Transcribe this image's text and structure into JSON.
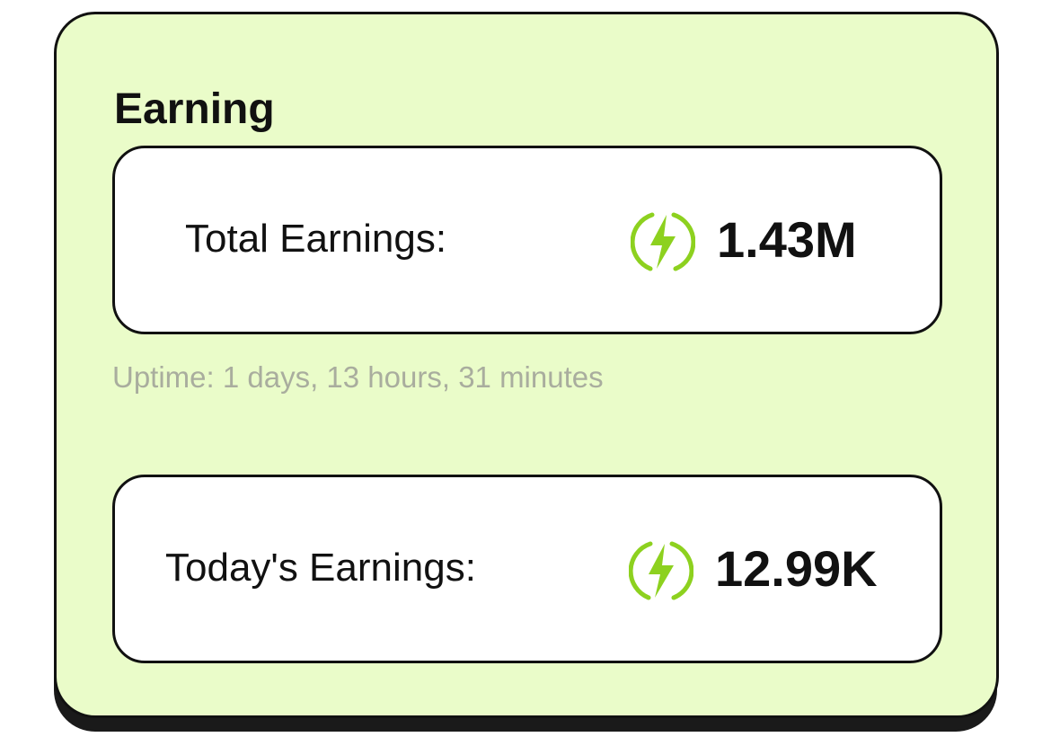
{
  "card": {
    "title": "Earning"
  },
  "total": {
    "label": "Total Earnings:",
    "value": "1.43M",
    "icon": "lightning-bolt-icon"
  },
  "uptime": {
    "text": "Uptime: 1 days, 13 hours, 31 minutes"
  },
  "today": {
    "label": "Today's Earnings:",
    "value": "12.99K",
    "icon": "lightning-bolt-icon"
  },
  "colors": {
    "card_background": "#eafcc9",
    "accent_green": "#8dd11f",
    "border": "#111111",
    "muted_text": "#a9ad9e"
  }
}
